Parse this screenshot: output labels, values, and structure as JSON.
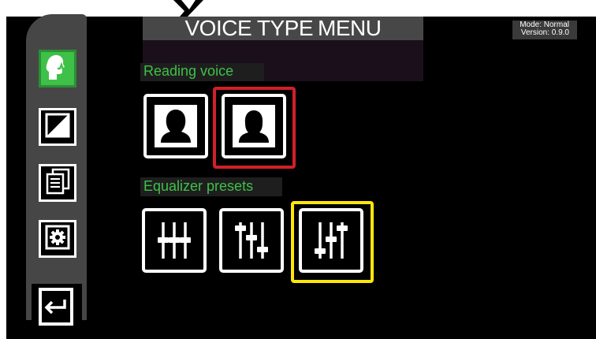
{
  "header": {
    "title_part1": "VOICE TYPE",
    "title_part2": "MENU",
    "mode": "Mode: Normal",
    "version": "Version: 0.9.0"
  },
  "sections": {
    "reading_voice": "Reading voice",
    "equalizer": "Equalizer presets"
  },
  "sidebar": {
    "items": [
      {
        "icon": "voice-type-icon",
        "active": true
      },
      {
        "icon": "contrast-icon",
        "active": false
      },
      {
        "icon": "documents-icon",
        "active": false
      },
      {
        "icon": "gear-icon",
        "active": false
      }
    ],
    "exit_icon": "return-arrow-icon"
  },
  "reading_voice_options": [
    {
      "icon": "female-voice-icon",
      "selected": false
    },
    {
      "icon": "male-voice-icon",
      "selected": true
    }
  ],
  "equalizer_options": [
    {
      "icon": "equalizer-flat-icon",
      "selected": false
    },
    {
      "icon": "equalizer-bass-icon",
      "selected": false
    },
    {
      "icon": "equalizer-treble-icon",
      "selected": true
    }
  ],
  "colors": {
    "accent_green": "#3fc048",
    "selected_voice": "#d12027",
    "selected_eq": "#ffe60a"
  }
}
